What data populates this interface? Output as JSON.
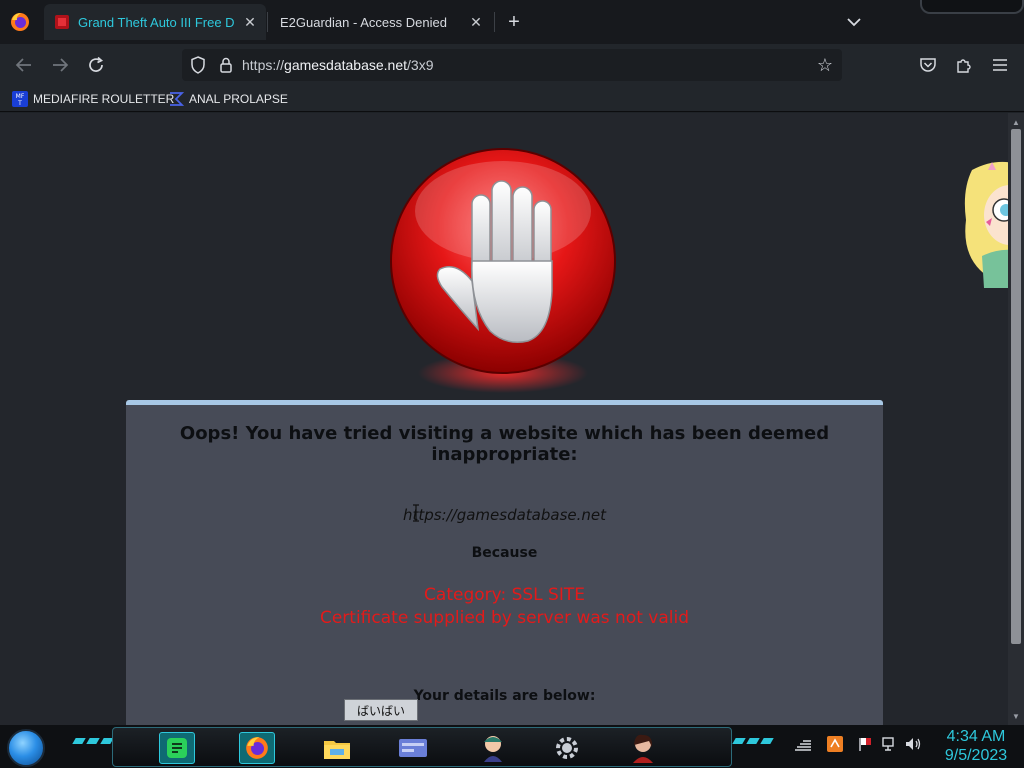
{
  "browser": {
    "tabs": [
      {
        "title": "Grand Theft Auto III Free Down",
        "active": true
      },
      {
        "title": "E2Guardian - Access Denied",
        "active": false
      }
    ],
    "new_tab_label": "+",
    "tab_list_label": "⌄",
    "url_prefix": "https://",
    "url_host": "gamesdatabase.net",
    "url_path": "/3x9",
    "bookmarks": [
      {
        "label": "MEDIAFIRE ROULETTER",
        "icon": "mediafire-icon"
      },
      {
        "label": "ANAL PROLAPSE",
        "icon": "sigma-icon"
      }
    ]
  },
  "page": {
    "heading": "Oops! You have tried visiting a website which has been deemed inappropriate:",
    "blocked_url": "https://gamesdatabase.net",
    "because_label": "Because",
    "reason_line1": "Category: SSL SITE",
    "reason_line2": "Certificate supplied by server was not valid",
    "details_label": "Your details are below:",
    "colors": {
      "reason": "#e31a1a",
      "panel": "#474b57",
      "panel_border": "#a8c8e6"
    }
  },
  "taskbar": {
    "ime_tooltip": "ばいばい",
    "time": "4:34 AM",
    "date": "9/5/2023",
    "accent": "#2ec8dc",
    "apps": [
      "notes-icon",
      "firefox-icon",
      "file-explorer-icon",
      "card-icon",
      "character-icon",
      "gear-icon",
      "avatar-icon"
    ],
    "tray": [
      "chevron-icon",
      "app-icon",
      "flag-icon",
      "network-icon",
      "volume-icon"
    ]
  }
}
